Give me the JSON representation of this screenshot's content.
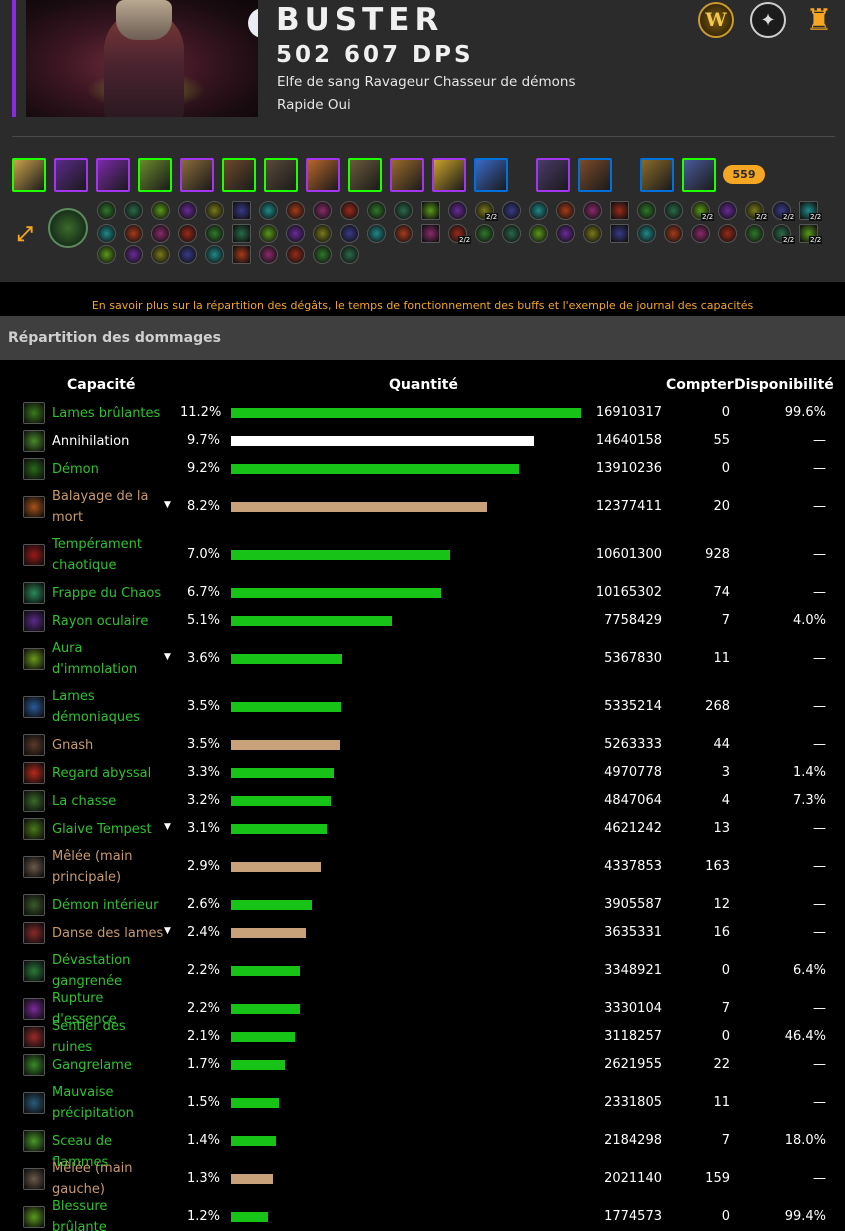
{
  "character": {
    "name": "BUSTER",
    "dps": "502 607 DPS",
    "description": "Elfe de sang Ravageur Chasseur de démons",
    "subline": "Rapide Oui"
  },
  "external_links": [
    {
      "name": "wow-armory-icon",
      "glyph": "W"
    },
    {
      "name": "raiderio-icon",
      "glyph": "✦"
    },
    {
      "name": "warcraftlogs-icon",
      "glyph": "♜"
    }
  ],
  "gear_items": [
    {
      "name": "head-gear-icon",
      "quality": "green",
      "color": "#c9a24a"
    },
    {
      "name": "neck-gear-icon",
      "quality": "purple",
      "color": "#5b2a8a"
    },
    {
      "name": "shoulder-gear-icon",
      "quality": "purple",
      "color": "#7a2aa8"
    },
    {
      "name": "back-gear-icon",
      "quality": "green",
      "color": "#6a8a2a"
    },
    {
      "name": "chest-gear-icon",
      "quality": "purple",
      "color": "#8a6a3a"
    },
    {
      "name": "wrist-gear-icon",
      "quality": "green",
      "color": "#6b4a2a"
    },
    {
      "name": "hands-gear-icon",
      "quality": "green",
      "color": "#5a4a3a"
    },
    {
      "name": "waist-gear-icon",
      "quality": "purple",
      "color": "#b8652a"
    },
    {
      "name": "legs-gear-icon",
      "quality": "green",
      "color": "#6a5a3a"
    },
    {
      "name": "feet-gear-icon",
      "quality": "purple",
      "color": "#9a6a2a"
    },
    {
      "name": "ring1-gear-icon",
      "quality": "purple",
      "color": "#c9a22a"
    },
    {
      "name": "ring2-gear-icon",
      "quality": "blue",
      "color": "#3a6ac9"
    },
    {
      "name": "trinket1-gear-icon",
      "quality": "purple",
      "color": "#4a3a6a"
    },
    {
      "name": "trinket2-gear-icon",
      "quality": "blue",
      "color": "#7a4a2a"
    },
    {
      "name": "mainhand-gear-icon",
      "quality": "blue",
      "color": "#8a6a2a"
    },
    {
      "name": "offhand-gear-icon",
      "quality": "green",
      "color": "#4a5a9a"
    }
  ],
  "item_level": "559",
  "talent_ranks": [
    "2/2",
    "2/2",
    "2/2",
    "2/2",
    "2/2",
    "2/2",
    "2/2",
    "2/2"
  ],
  "info_link": "En savoir plus sur la répartition des dégâts, le temps de fonctionnement des buffs et l'exemple de journal des capacités",
  "section_title": "Répartition des dommages",
  "table": {
    "headers": {
      "ability": "Capacité",
      "amount": "Quantité",
      "count": "Compter",
      "uptime": "Disponibilité"
    },
    "rows": [
      {
        "name": "Lames brûlantes",
        "pct": "11.2%",
        "fraction": 1.0,
        "amount": "16910317",
        "count": "0",
        "uptime": "99.6%",
        "style": "green",
        "caret": false,
        "icon_color": "#3a7a1a"
      },
      {
        "name": "Annihilation",
        "pct": "9.7%",
        "fraction": 0.866,
        "amount": "14640158",
        "count": "55",
        "uptime": "—",
        "style": "white",
        "caret": false,
        "icon_color": "#4a8a2a"
      },
      {
        "name": "Démon",
        "pct": "9.2%",
        "fraction": 0.823,
        "amount": "13910236",
        "count": "0",
        "uptime": "—",
        "style": "green",
        "caret": false,
        "icon_color": "#2a6a1a"
      },
      {
        "name": "Balayage de la mort",
        "pct": "8.2%",
        "fraction": 0.732,
        "amount": "12377411",
        "count": "20",
        "uptime": "—",
        "style": "tan",
        "caret": true,
        "icon_color": "#a8521a"
      },
      {
        "name": "Tempérament chaotique",
        "pct": "7.0%",
        "fraction": 0.627,
        "amount": "10601300",
        "count": "928",
        "uptime": "—",
        "style": "green",
        "caret": false,
        "icon_color": "#9a1a1a"
      },
      {
        "name": "Frappe du Chaos",
        "pct": "6.7%",
        "fraction": 0.601,
        "amount": "10165302",
        "count": "74",
        "uptime": "—",
        "style": "green",
        "caret": false,
        "icon_color": "#2a8a5a"
      },
      {
        "name": "Rayon oculaire",
        "pct": "5.1%",
        "fraction": 0.459,
        "amount": "7758429",
        "count": "7",
        "uptime": "4.0%",
        "style": "green",
        "caret": false,
        "icon_color": "#5a2a8a"
      },
      {
        "name": "Aura d'immolation",
        "pct": "3.6%",
        "fraction": 0.317,
        "amount": "5367830",
        "count": "11",
        "uptime": "—",
        "style": "green",
        "caret": true,
        "icon_color": "#6a9a1a"
      },
      {
        "name": "Lames démoniaques",
        "pct": "3.5%",
        "fraction": 0.315,
        "amount": "5335214",
        "count": "268",
        "uptime": "—",
        "style": "green",
        "caret": false,
        "icon_color": "#2a5a9a"
      },
      {
        "name": "Gnash",
        "pct": "3.5%",
        "fraction": 0.311,
        "amount": "5263333",
        "count": "44",
        "uptime": "—",
        "style": "tan",
        "caret": false,
        "icon_color": "#5a3a2a"
      },
      {
        "name": "Regard abyssal",
        "pct": "3.3%",
        "fraction": 0.294,
        "amount": "4970778",
        "count": "3",
        "uptime": "1.4%",
        "style": "green",
        "caret": false,
        "icon_color": "#b82a1a"
      },
      {
        "name": "La chasse",
        "pct": "3.2%",
        "fraction": 0.287,
        "amount": "4847064",
        "count": "4",
        "uptime": "7.3%",
        "style": "green",
        "caret": false,
        "icon_color": "#3a6a2a"
      },
      {
        "name": "Glaive Tempest",
        "pct": "3.1%",
        "fraction": 0.273,
        "amount": "4621242",
        "count": "13",
        "uptime": "—",
        "style": "green",
        "caret": true,
        "icon_color": "#4a7a1a"
      },
      {
        "name": "Mêlée (main principale)",
        "pct": "2.9%",
        "fraction": 0.257,
        "amount": "4337853",
        "count": "163",
        "uptime": "—",
        "style": "tan",
        "caret": false,
        "icon_color": "#6a5a4a"
      },
      {
        "name": "Démon intérieur",
        "pct": "2.6%",
        "fraction": 0.231,
        "amount": "3905587",
        "count": "12",
        "uptime": "—",
        "style": "green",
        "caret": false,
        "icon_color": "#3a5a2a"
      },
      {
        "name": "Danse des lames",
        "pct": "2.4%",
        "fraction": 0.215,
        "amount": "3635331",
        "count": "16",
        "uptime": "—",
        "style": "tan",
        "caret": true,
        "icon_color": "#8a2a2a"
      },
      {
        "name": "Dévastation gangrenée",
        "pct": "2.2%",
        "fraction": 0.198,
        "amount": "3348921",
        "count": "0",
        "uptime": "6.4%",
        "style": "green",
        "caret": false,
        "icon_color": "#2a7a3a"
      },
      {
        "name": "Rupture d'essence",
        "pct": "2.2%",
        "fraction": 0.197,
        "amount": "3330104",
        "count": "7",
        "uptime": "—",
        "style": "green",
        "caret": false,
        "icon_color": "#7a2a9a"
      },
      {
        "name": "Sentier des ruines",
        "pct": "2.1%",
        "fraction": 0.184,
        "amount": "3118257",
        "count": "0",
        "uptime": "46.4%",
        "style": "green",
        "caret": false,
        "icon_color": "#9a2a2a"
      },
      {
        "name": "Gangrelame",
        "pct": "1.7%",
        "fraction": 0.155,
        "amount": "2621955",
        "count": "22",
        "uptime": "—",
        "style": "green",
        "caret": false,
        "icon_color": "#3a8a2a"
      },
      {
        "name": "Mauvaise précipitation",
        "pct": "1.5%",
        "fraction": 0.138,
        "amount": "2331805",
        "count": "11",
        "uptime": "—",
        "style": "green",
        "caret": false,
        "icon_color": "#2a5a7a"
      },
      {
        "name": "Sceau de flammes",
        "pct": "1.4%",
        "fraction": 0.129,
        "amount": "2184298",
        "count": "7",
        "uptime": "18.0%",
        "style": "green",
        "caret": false,
        "icon_color": "#4a9a2a"
      },
      {
        "name": "Mêlée (main gauche)",
        "pct": "1.3%",
        "fraction": 0.12,
        "amount": "2021140",
        "count": "159",
        "uptime": "—",
        "style": "tan",
        "caret": false,
        "icon_color": "#6a5a4a"
      },
      {
        "name": "Blessure brûlante",
        "pct": "1.2%",
        "fraction": 0.105,
        "amount": "1774573",
        "count": "0",
        "uptime": "99.4%",
        "style": "green",
        "caret": false,
        "icon_color": "#5a9a1a"
      }
    ]
  }
}
